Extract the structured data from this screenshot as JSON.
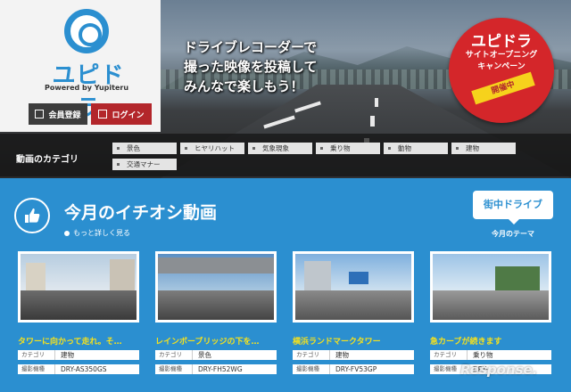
{
  "brand": {
    "name": "ユピドラ",
    "tagline": "Powered by Yupiteru"
  },
  "auth": {
    "member_label": "会員登録",
    "login_label": "ログイン"
  },
  "hero": {
    "lines": [
      "ドライブレコーダーで",
      "撮った映像を投稿して",
      "みんなで楽しもう！"
    ]
  },
  "campaign": {
    "title": "ユピドラ",
    "sub": [
      "サイトオープニング",
      "キャンペーン"
    ],
    "ribbon": "開催中"
  },
  "categories": {
    "label": "動画のカテゴリ",
    "items": [
      "景色",
      "ヒヤリハット",
      "気象現象",
      "乗り物",
      "動物",
      "建物",
      "交通マナー"
    ]
  },
  "featured": {
    "title": "今月のイチオシ動画",
    "more": "もっと詳しく見る",
    "theme_button": "街中ドライブ",
    "theme_label": "今月のテーマ",
    "cards": [
      {
        "title": "タワーに向かって走れ。そ…",
        "cat_key": "カテゴリ",
        "cat": "建物",
        "dev_key": "撮影機種",
        "device": "DRY-AS350GS"
      },
      {
        "title": "レインボーブリッジの下を…",
        "cat_key": "カテゴリ",
        "cat": "景色",
        "dev_key": "撮影機種",
        "device": "DRY-FH52WG"
      },
      {
        "title": "横浜ランドマークタワー",
        "cat_key": "カテゴリ",
        "cat": "建物",
        "dev_key": "撮影機種",
        "device": "DRY-FV53GP"
      },
      {
        "title": "急カーブが続きます",
        "cat_key": "カテゴリ",
        "cat": "乗り物",
        "dev_key": "撮影機種",
        "device": "DRY-"
      }
    ]
  },
  "watermark": "Response."
}
